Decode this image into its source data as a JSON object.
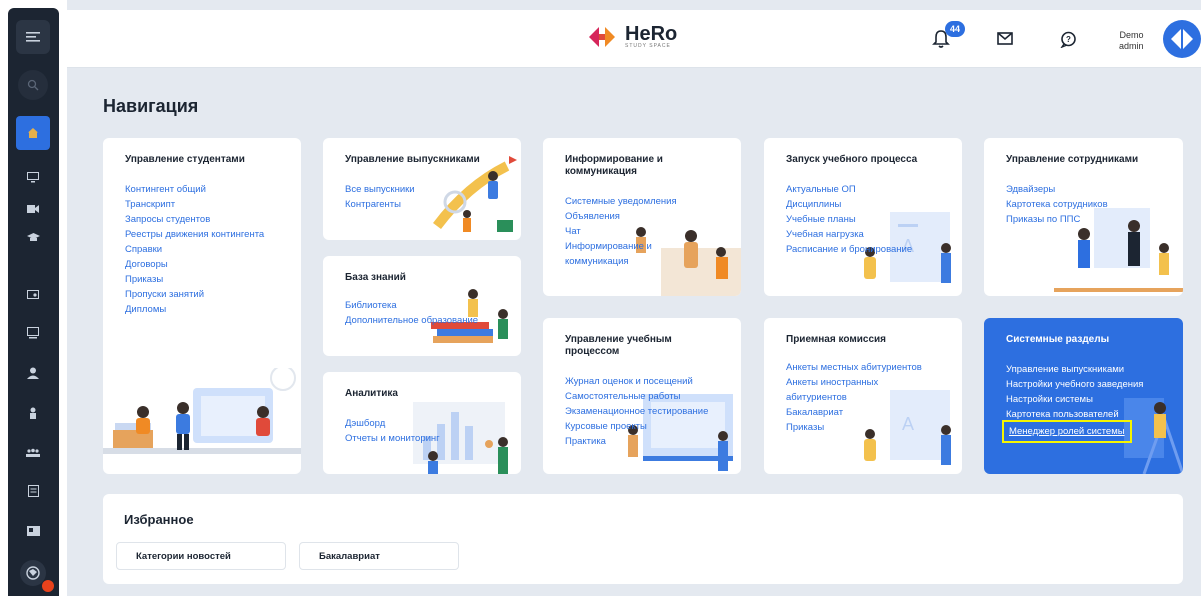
{
  "header": {
    "logo_title": "HeRo",
    "logo_subtitle": "STUDY SPACE",
    "notifications_count": "44",
    "user_name": "Demo",
    "user_role": "admin"
  },
  "sidebar": {
    "icons": [
      "menu-icon",
      "search-icon",
      "home-icon",
      "monitor-icon",
      "video-icon",
      "graduation-cap-icon",
      "certificate-icon",
      "presentation-icon",
      "user-icon",
      "person-icon",
      "group-icon",
      "document-icon",
      "id-card-icon",
      "globe-icon"
    ]
  },
  "page_title": "Навигация",
  "cards": {
    "students": {
      "title": "Управление студентами",
      "links": [
        "Контингент общий",
        "Транскрипт",
        "Запросы студентов",
        "Реестры движения контингента",
        "Справки",
        "Договоры",
        "Приказы",
        "Пропуски занятий",
        "Дипломы"
      ]
    },
    "graduates": {
      "title": "Управление выпускниками",
      "links": [
        "Все выпускники",
        "Контрагенты"
      ]
    },
    "knowledge": {
      "title": "База знаний",
      "links": [
        "Библиотека",
        "Дополнительное образование"
      ]
    },
    "analytics": {
      "title": "Аналитика",
      "links": [
        "Дэшборд",
        "Отчеты и мониторинг"
      ]
    },
    "info": {
      "title": "Информирование и коммуникация",
      "links": [
        "Системные уведомления",
        "Объявления",
        "Чат",
        "Информирование и",
        "коммуникация"
      ]
    },
    "process_mgmt": {
      "title": "Управление учебным процессом",
      "links": [
        "Журнал оценок и посещений",
        "Самостоятельные работы",
        "Экзаменационное тестирование",
        "Курсовые проекты",
        "Практика"
      ]
    },
    "launch": {
      "title": "Запуск учебного процесса",
      "links": [
        "Актуальные ОП",
        "Дисциплины",
        "Учебные планы",
        "Учебная нагрузка",
        "Расписание и бронирование"
      ]
    },
    "admission": {
      "title": "Приемная комиссия",
      "links": [
        "Анкеты местных абитуриентов",
        "Анкеты иностранных",
        "абитуриентов",
        "Бакалавриат",
        "Приказы"
      ]
    },
    "staff": {
      "title": "Управление сотрудниками",
      "links": [
        "Эдвайзеры",
        "Картотека сотрудников",
        "Приказы по ППС"
      ]
    },
    "system": {
      "title": "Системные разделы",
      "links": [
        "Управление выпускниками",
        "Настройки учебного заведения",
        "Настройки системы",
        "Картотека пользователей",
        "Менеджер ролей системы"
      ]
    }
  },
  "favorites": {
    "title": "Избранное",
    "items": [
      "Категории новостей",
      "Бакалавриат"
    ]
  },
  "colors": {
    "accent": "#2d6fe0",
    "sidebar_bg": "#1c2532",
    "page_bg": "#e4e9f0",
    "highlight": "#f5f500",
    "notification_dot": "#e8421c"
  }
}
